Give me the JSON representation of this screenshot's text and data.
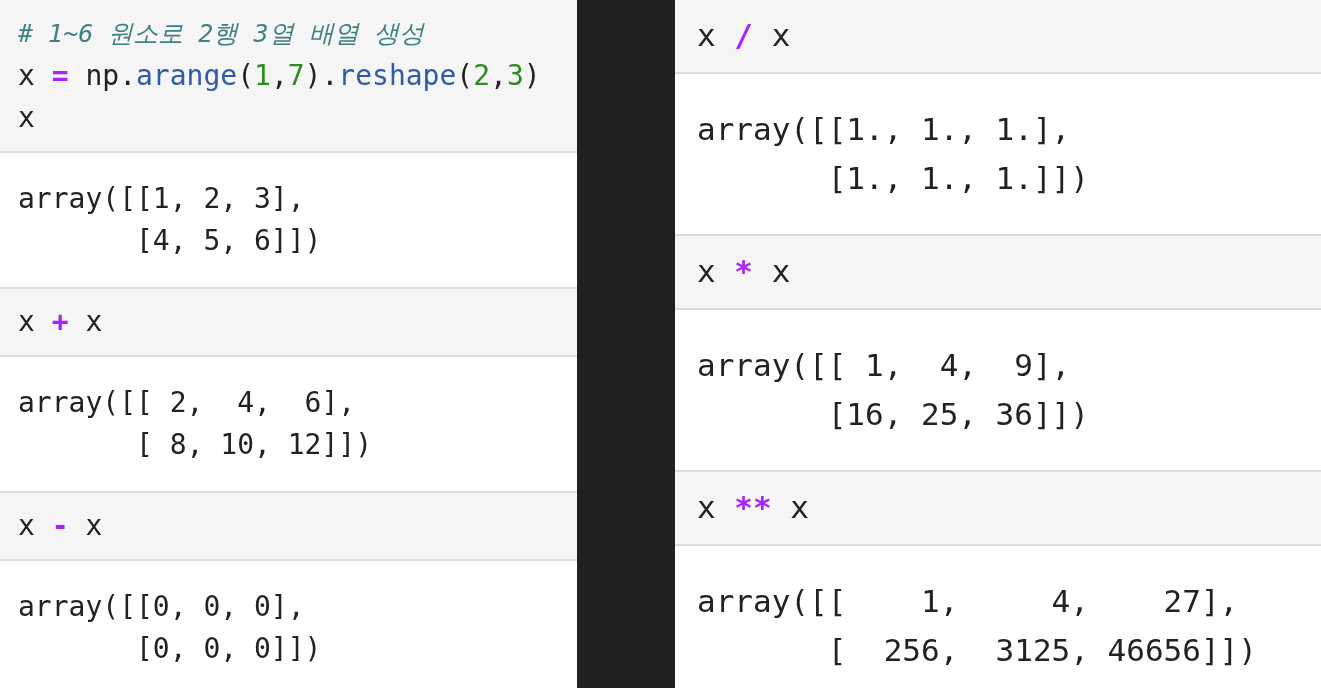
{
  "panels": [
    {
      "cells": [
        {
          "kind": "input",
          "lines": [
            [
              {
                "kind": "comment",
                "text": "# 1~6 원소로 2행 3열 배열 생성"
              }
            ],
            [
              {
                "kind": "name",
                "text": "x "
              },
              {
                "kind": "operator",
                "text": "="
              },
              {
                "kind": "name",
                "text": " np."
              },
              {
                "kind": "function",
                "text": "arange"
              },
              {
                "kind": "name",
                "text": "("
              },
              {
                "kind": "number",
                "text": "1"
              },
              {
                "kind": "name",
                "text": ","
              },
              {
                "kind": "number",
                "text": "7"
              },
              {
                "kind": "name",
                "text": ")."
              },
              {
                "kind": "function",
                "text": "reshape"
              },
              {
                "kind": "name",
                "text": "("
              },
              {
                "kind": "number",
                "text": "2"
              },
              {
                "kind": "name",
                "text": ","
              },
              {
                "kind": "number",
                "text": "3"
              },
              {
                "kind": "name",
                "text": ")"
              }
            ],
            [
              {
                "kind": "name",
                "text": "x"
              }
            ]
          ]
        },
        {
          "kind": "output",
          "lines": [
            "array([[1, 2, 3],",
            "       [4, 5, 6]])"
          ]
        },
        {
          "kind": "input",
          "lines": [
            [
              {
                "kind": "name",
                "text": "x "
              },
              {
                "kind": "operator",
                "text": "+"
              },
              {
                "kind": "name",
                "text": " x"
              }
            ]
          ]
        },
        {
          "kind": "output",
          "lines": [
            "array([[ 2,  4,  6],",
            "       [ 8, 10, 12]])"
          ]
        },
        {
          "kind": "input",
          "lines": [
            [
              {
                "kind": "name",
                "text": "x "
              },
              {
                "kind": "operator",
                "text": "-"
              },
              {
                "kind": "name",
                "text": " x"
              }
            ]
          ]
        },
        {
          "kind": "output",
          "lines": [
            "array([[0, 0, 0],",
            "       [0, 0, 0]])"
          ]
        }
      ]
    },
    {
      "cells": [
        {
          "kind": "input",
          "lines": [
            [
              {
                "kind": "name",
                "text": "x "
              },
              {
                "kind": "operator",
                "text": "/"
              },
              {
                "kind": "name",
                "text": " x"
              }
            ]
          ]
        },
        {
          "kind": "output",
          "lines": [
            "array([[1., 1., 1.],",
            "       [1., 1., 1.]])"
          ]
        },
        {
          "kind": "input",
          "lines": [
            [
              {
                "kind": "name",
                "text": "x "
              },
              {
                "kind": "operator",
                "text": "*"
              },
              {
                "kind": "name",
                "text": " x"
              }
            ]
          ]
        },
        {
          "kind": "output",
          "lines": [
            "array([[ 1,  4,  9],",
            "       [16, 25, 36]])"
          ]
        },
        {
          "kind": "input",
          "lines": [
            [
              {
                "kind": "name",
                "text": "x "
              },
              {
                "kind": "operator",
                "text": "**"
              },
              {
                "kind": "name",
                "text": " x"
              }
            ]
          ]
        },
        {
          "kind": "output",
          "lines": [
            "array([[    1,     4,    27],",
            "       [  256,  3125, 46656]])"
          ]
        }
      ]
    }
  ]
}
